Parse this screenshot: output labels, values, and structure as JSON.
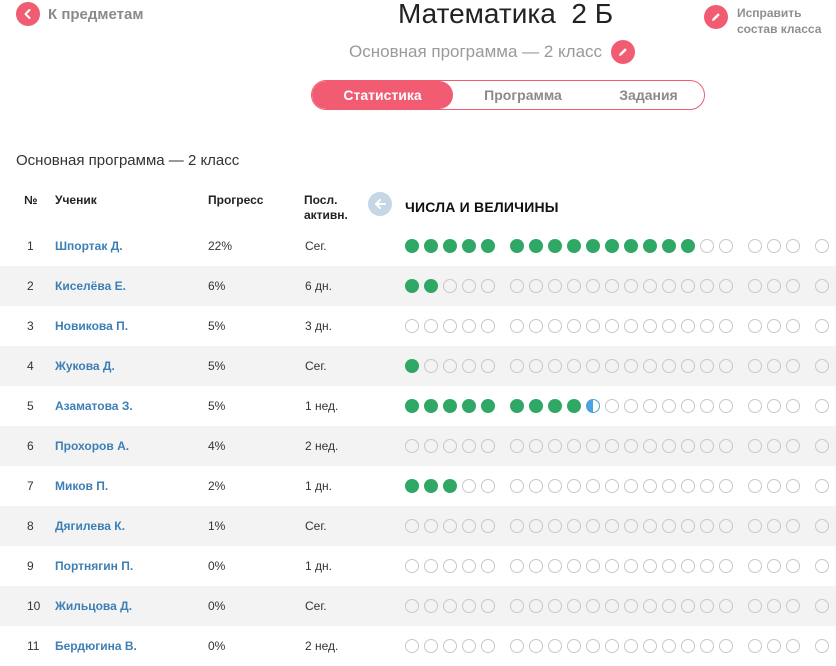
{
  "header": {
    "back_label": "К предметам",
    "title": "Математика  2 Б",
    "subtitle": "Основная программа — 2 класс",
    "fix_label": "Исправить состав класса",
    "accent_color": "#f25c72"
  },
  "tabs": [
    {
      "label": "Статистика",
      "active": true
    },
    {
      "label": "Программа",
      "active": false
    },
    {
      "label": "Задания",
      "active": false
    }
  ],
  "program_label": "Основная программа — 2 класс",
  "table": {
    "columns": {
      "num": "№",
      "student": "Ученик",
      "progress": "Прогресс",
      "activity": "Посл. активн."
    },
    "section_title": "ЧИСЛА И ВЕЛИЧИНЫ",
    "dot_colors": {
      "complete": "#2fa865",
      "partial": "#4aa3df",
      "empty": "#c8c8c8"
    },
    "rows": [
      {
        "num": "1",
        "name": "Шпортак Д.",
        "progress": "22%",
        "activity": "Сег.",
        "dots": [
          "f",
          "f",
          "f",
          "f",
          "f",
          "|",
          "f",
          "f",
          "f",
          "f",
          "f",
          "f",
          "f",
          "f",
          "f",
          "f",
          "e",
          "e",
          "|",
          "e",
          "e",
          "e",
          "|",
          "e"
        ]
      },
      {
        "num": "2",
        "name": "Киселёва Е.",
        "progress": "6%",
        "activity": "6 дн.",
        "dots": [
          "f",
          "f",
          "e",
          "e",
          "e",
          "|",
          "e",
          "e",
          "e",
          "e",
          "e",
          "e",
          "e",
          "e",
          "e",
          "e",
          "e",
          "e",
          "|",
          "e",
          "e",
          "e",
          "|",
          "e"
        ]
      },
      {
        "num": "3",
        "name": "Новикова П.",
        "progress": "5%",
        "activity": "3 дн.",
        "dots": [
          "e",
          "e",
          "e",
          "e",
          "e",
          "|",
          "e",
          "e",
          "e",
          "e",
          "e",
          "e",
          "e",
          "e",
          "e",
          "e",
          "e",
          "e",
          "|",
          "e",
          "e",
          "e",
          "|",
          "e"
        ]
      },
      {
        "num": "4",
        "name": "Жукова Д.",
        "progress": "5%",
        "activity": "Сег.",
        "dots": [
          "f",
          "e",
          "e",
          "e",
          "e",
          "|",
          "e",
          "e",
          "e",
          "e",
          "e",
          "e",
          "e",
          "e",
          "e",
          "e",
          "e",
          "e",
          "|",
          "e",
          "e",
          "e",
          "|",
          "e"
        ]
      },
      {
        "num": "5",
        "name": "Азаматова З.",
        "progress": "5%",
        "activity": "1 нед.",
        "dots": [
          "f",
          "f",
          "f",
          "f",
          "f",
          "|",
          "f",
          "f",
          "f",
          "f",
          "h",
          "e",
          "e",
          "e",
          "e",
          "e",
          "e",
          "e",
          "|",
          "e",
          "e",
          "e",
          "|",
          "e"
        ]
      },
      {
        "num": "6",
        "name": "Прохоров А.",
        "progress": "4%",
        "activity": "2 нед.",
        "dots": [
          "e",
          "e",
          "e",
          "e",
          "e",
          "|",
          "e",
          "e",
          "e",
          "e",
          "e",
          "e",
          "e",
          "e",
          "e",
          "e",
          "e",
          "e",
          "|",
          "e",
          "e",
          "e",
          "|",
          "e"
        ]
      },
      {
        "num": "7",
        "name": "Миков П.",
        "progress": "2%",
        "activity": "1 дн.",
        "dots": [
          "f",
          "f",
          "f",
          "e",
          "e",
          "|",
          "e",
          "e",
          "e",
          "e",
          "e",
          "e",
          "e",
          "e",
          "e",
          "e",
          "e",
          "e",
          "|",
          "e",
          "e",
          "e",
          "|",
          "e"
        ]
      },
      {
        "num": "8",
        "name": "Дягилева К.",
        "progress": "1%",
        "activity": "Сег.",
        "dots": [
          "e",
          "e",
          "e",
          "e",
          "e",
          "|",
          "e",
          "e",
          "e",
          "e",
          "e",
          "e",
          "e",
          "e",
          "e",
          "e",
          "e",
          "e",
          "|",
          "e",
          "e",
          "e",
          "|",
          "e"
        ]
      },
      {
        "num": "9",
        "name": "Портнягин П.",
        "progress": "0%",
        "activity": "1 дн.",
        "dots": [
          "e",
          "e",
          "e",
          "e",
          "e",
          "|",
          "e",
          "e",
          "e",
          "e",
          "e",
          "e",
          "e",
          "e",
          "e",
          "e",
          "e",
          "e",
          "|",
          "e",
          "e",
          "e",
          "|",
          "e"
        ]
      },
      {
        "num": "10",
        "name": "Жильцова Д.",
        "progress": "0%",
        "activity": "Сег.",
        "dots": [
          "e",
          "e",
          "e",
          "e",
          "e",
          "|",
          "e",
          "e",
          "e",
          "e",
          "e",
          "e",
          "e",
          "e",
          "e",
          "e",
          "e",
          "e",
          "|",
          "e",
          "e",
          "e",
          "|",
          "e"
        ]
      },
      {
        "num": "11",
        "name": "Бердюгина В.",
        "progress": "0%",
        "activity": "2 нед.",
        "dots": [
          "e",
          "e",
          "e",
          "e",
          "e",
          "|",
          "e",
          "e",
          "e",
          "e",
          "e",
          "e",
          "e",
          "e",
          "e",
          "e",
          "e",
          "e",
          "|",
          "e",
          "e",
          "e",
          "|",
          "e"
        ]
      }
    ]
  }
}
